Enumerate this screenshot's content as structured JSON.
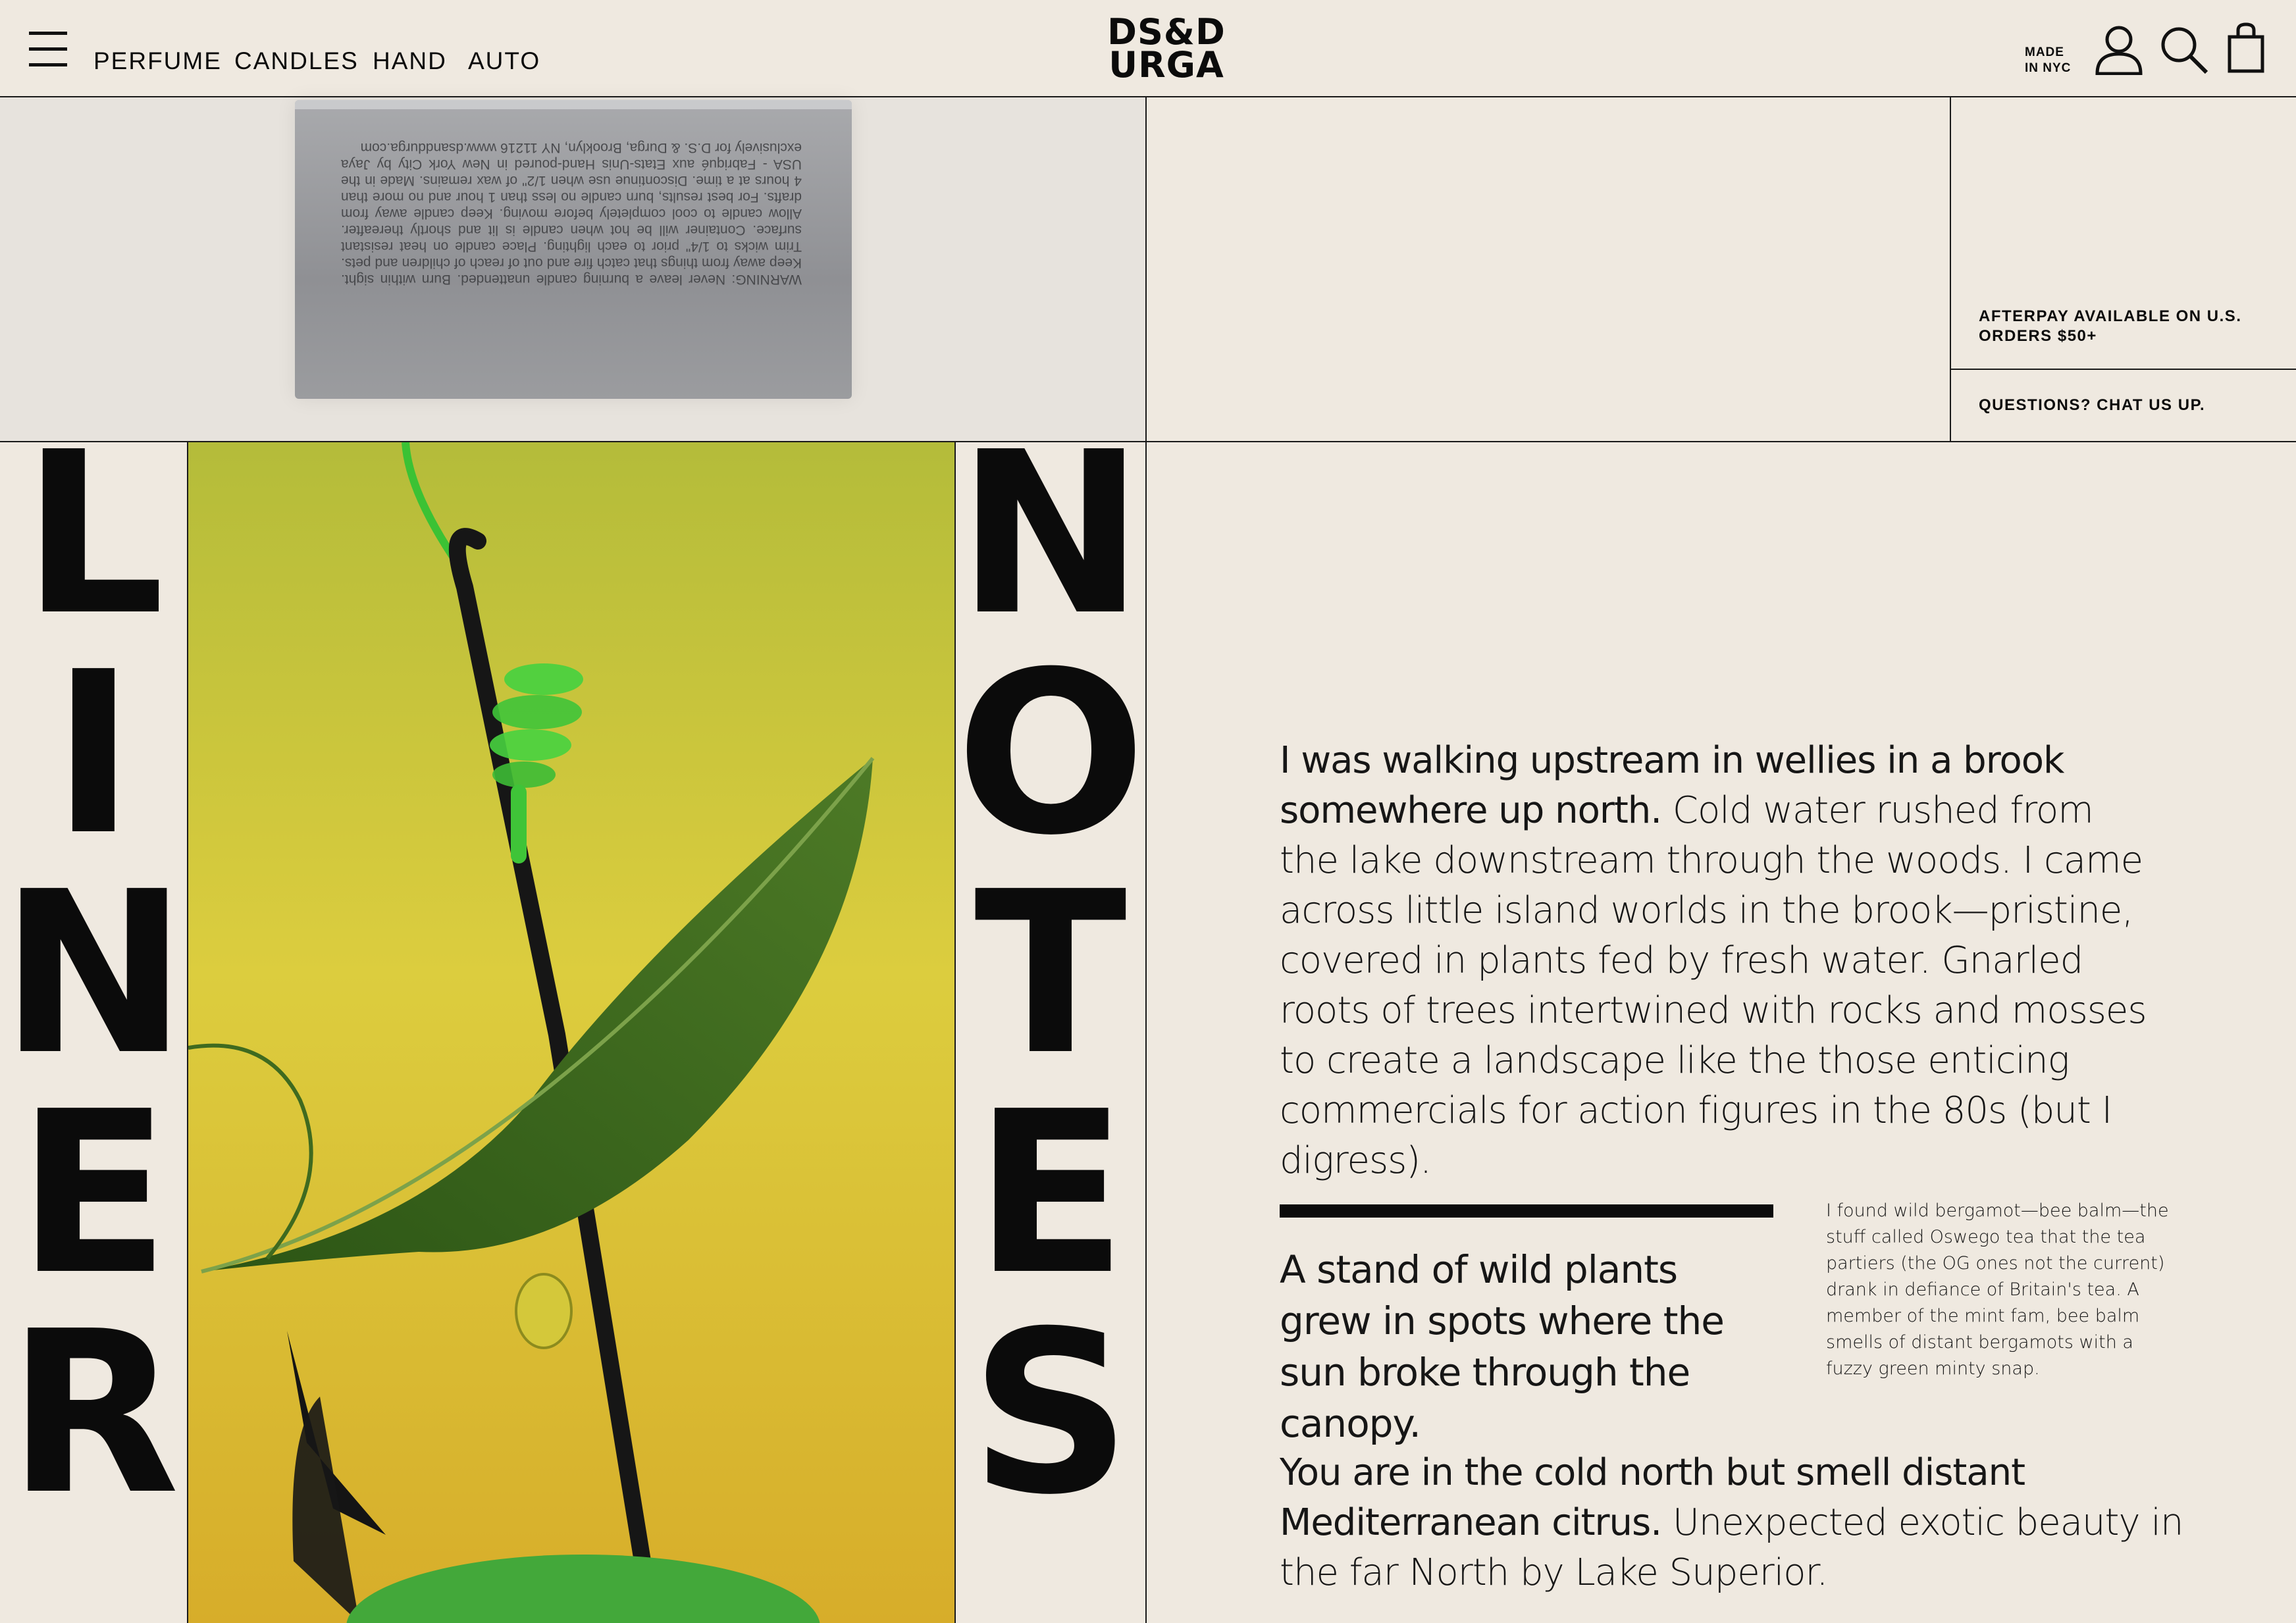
{
  "header": {
    "nav": [
      "PERFUME",
      "CANDLES",
      "HAND",
      "AUTO"
    ],
    "logo_line1": "DS&D",
    "logo_line2": "URGA",
    "made_line1": "MADE",
    "made_line2": "IN NYC"
  },
  "product": {
    "label_text": "WARNING: Never leave a burning candle unattended. Burn within sight. Keep away from things that catch fire and out of reach of children and pets. Trim wicks to 1/4\" prior to each lighting. Place candle on heat resistant surface. Container will be hot when candle is lit and shortly thereafter. Allow candle to cool completely before moving. Keep candle away from drafts. For best results, burn candle no less than 1 hour and no more than 4 hours at a time. Discontinue use when 1/2\" of wax remains. Made in the USA - Fabriqué aux Etats-Unis Hand-poured in New York City by Jaya exclusively for D.S. & Durga, Brooklyn, NY 11216 www.dsanddurga.com"
  },
  "sidebar": {
    "afterpay": "AFTERPAY AVAILABLE ON U.S. ORDERS $50+",
    "questions": "QUESTIONS? CHAT US UP."
  },
  "liner": [
    "L",
    "I",
    "N",
    "E",
    "R"
  ],
  "notes": [
    "N",
    "O",
    "T",
    "E",
    "S"
  ],
  "article": {
    "p1_bold": "I was walking upstream in wellies in a brook somewhere up north.",
    "p1_rest": " Cold water rushed from the lake downstream through the woods. I came across little island worlds in the brook—pristine, covered in plants fed by fresh water. Gnarled roots of trees intertwined with rocks and mosses to create a landscape like the those enticing commercials for action figures in the 80s (but I digress).",
    "quote": "A stand of wild plants grew in spots where the sun broke through the canopy.",
    "aside": "I found wild bergamot—bee balm—the stuff called Oswego tea that the tea partiers (the OG ones not the current) drank in defiance of Britain's tea. A member of the mint fam, bee balm smells of distant bergamots with a fuzzy green minty snap.",
    "p2_bold": "You are in the cold north but smell distant Mediterranean citrus.",
    "p2_rest": " Unexpected exotic beauty in the far North by Lake Superior."
  },
  "colors": {
    "background": "#efe9e0",
    "ink": "#0b0b0b",
    "photo_yellow": "#d7c43a",
    "leaf_green": "#3f6a1f",
    "line_green": "#43c93a"
  }
}
